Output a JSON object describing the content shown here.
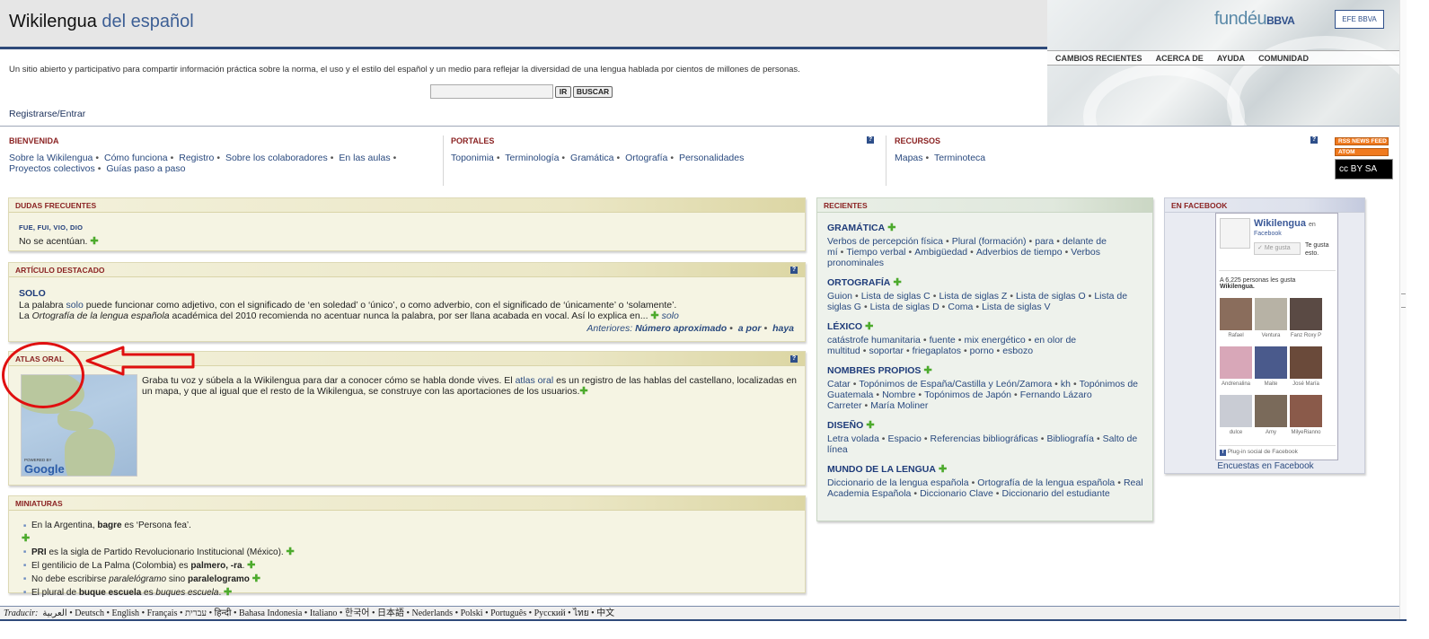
{
  "header": {
    "title_main": "Wikilengua",
    "title_sub": " del español",
    "tagline": "Un sitio abierto y participativo para compartir información práctica sobre la norma, el uso y el estilo del español y un medio para reflejar la diversidad de una lengua hablada por cientos de millones de personas.",
    "search": {
      "value": "",
      "go_label": "IR",
      "search_label": "BUSCAR"
    },
    "login_label": "Registrarse/Entrar",
    "fundeu": "fundéu",
    "fundeu_bbva": "BBVA",
    "efe_logo": "EFE  BBVA",
    "nav": [
      "CAMBIOS RECIENTES",
      "ACERCA DE",
      "AYUDA",
      "COMUNIDAD"
    ]
  },
  "portals": {
    "bienvenida": {
      "title": "BIENVENIDA",
      "links": [
        "Sobre la Wikilengua",
        "Cómo funciona",
        "Registro",
        "Sobre los colaboradores",
        "En las aulas",
        "Proyectos colectivos",
        "Guías paso a paso"
      ]
    },
    "portales": {
      "title": "PORTALES",
      "links": [
        "Toponimia",
        "Terminología",
        "Gramática",
        "Ortografía",
        "Personalidades"
      ]
    },
    "recursos": {
      "title": "RECURSOS",
      "links": [
        "Mapas",
        "Terminoteca"
      ]
    },
    "help_glyph": "?"
  },
  "feeds": {
    "rss": "RSS NEWS FEED",
    "atom": "ATOM",
    "cc": "cc  BY  SA"
  },
  "dudas": {
    "title": "DUDAS FRECUENTES",
    "item_title": "FUE, FUI, VIO, DIO",
    "item_text": "No se acentúan."
  },
  "articulo": {
    "title": "ARTÍCULO DESTACADO",
    "word": "SOLO",
    "p1_a": "La palabra ",
    "p1_link": "solo",
    "p1_b": " puede funcionar como adjetivo, con el significado de ‘en soledad’ o ‘único’, o como adverbio, con el significado de ‘únicamente’ o ‘solamente’.",
    "p2_a": "La ",
    "p2_em": "Ortografía de la lengua española",
    "p2_b": " académica del 2010 recomienda no acentuar nunca la palabra, por ser llana acabada en vocal. Así lo explica en...",
    "p2_more": "solo",
    "prev_label": "Anteriores:",
    "prev": [
      "Número aproximado",
      "a por",
      "haya"
    ]
  },
  "atlas": {
    "title": "ATLAS ORAL",
    "text_a": "Graba tu voz y súbela a la Wikilengua para dar a conocer cómo se habla donde vives. El ",
    "text_link": "atlas oral",
    "text_b": " es un registro de las hablas del castellano, localizadas en un mapa, y que al igual que el resto de la Wikilengua, se construye con las aportaciones de los usuarios.",
    "map_powered": "POWERED BY",
    "map_google": "Google"
  },
  "miniaturas": {
    "title": "MINIATURAS",
    "items": [
      {
        "a": "En la Argentina, ",
        "b": "bagre",
        "c": " es ‘Persona fea’.",
        "d": "",
        "e": ""
      },
      {
        "a": "",
        "b": "PRI",
        "c": " es la sigla de Partido Revolucionario Institucional (México).",
        "d": "",
        "e": ""
      },
      {
        "a": "El gentilicio de La Palma (Colombia) es ",
        "b": "palmero, -ra",
        "c": ".",
        "d": "",
        "e": ""
      },
      {
        "a": "No debe escribirse ",
        "b": "paralelógramo",
        "c": " sino ",
        "d": "paralelogramo",
        "e": ""
      },
      {
        "a": "El plural de ",
        "b": "buque escuela",
        "c": " es ",
        "d": "buques escuela",
        "e": "."
      }
    ]
  },
  "recientes": {
    "title": "RECIENTES",
    "cats": [
      {
        "name": "GRAMÁTICA",
        "links": [
          "Verbos de percepción física",
          "Plural (formación)",
          "para",
          "delante de mí",
          "Tiempo verbal",
          "Ambigüedad",
          "Adverbios de tiempo",
          "Verbos pronominales"
        ]
      },
      {
        "name": "ORTOGRAFÍA",
        "links": [
          "Guion",
          "Lista de siglas C",
          "Lista de siglas Z",
          "Lista de siglas O",
          "Lista de siglas G",
          "Lista de siglas D",
          "Coma",
          "Lista de siglas V"
        ]
      },
      {
        "name": "LÉXICO",
        "links": [
          "catástrofe humanitaria",
          "fuente",
          "mix energético",
          "en olor de multitud",
          "soportar",
          "friegaplatos",
          "porno",
          "esbozo"
        ]
      },
      {
        "name": "NOMBRES PROPIOS",
        "links": [
          "Catar",
          "Topónimos de España/Castilla y León/Zamora",
          "kh",
          "Topónimos de Guatemala",
          "Nombre",
          "Topónimos de Japón",
          "Fernando Lázaro Carreter",
          "María Moliner"
        ]
      },
      {
        "name": "DISEÑO",
        "links": [
          "Letra volada",
          "Espacio",
          "Referencias bibliográficas",
          "Bibliografía",
          "Salto de línea"
        ]
      },
      {
        "name": "MUNDO DE LA LENGUA",
        "links": [
          "Diccionario de la lengua española",
          "Ortografía de la lengua española",
          "Real Academia Española",
          "Diccionario Clave",
          "Diccionario del estudiante"
        ]
      }
    ]
  },
  "facebook": {
    "title": "EN FACEBOOK",
    "page_name": "Wikilengua",
    "page_on": "en",
    "page_fb": "Facebook",
    "like_label": "Me gusta",
    "like_text": "Te gusta esto.",
    "count_text": "A 6,225 personas les gusta",
    "count_page": "Wikilengua.",
    "faces": [
      "Rafael",
      "Ventura",
      "Fanz Roxy P",
      "Andrenalina",
      "Maite",
      "José María",
      "dulce",
      "Amy",
      "MilyeRianno"
    ],
    "plugin_label": "Plug-in social de Facebook",
    "polls_link": "Encuestas en Facebook"
  },
  "translate": {
    "label": "Traducir:",
    "langs": [
      "العربية",
      "Deutsch",
      "English",
      "Français",
      "עברית",
      "हिन्दी",
      "Bahasa Indonesia",
      "Italiano",
      "한국어",
      "日本語",
      "Nederlands",
      "Polski",
      "Português",
      "Русский",
      "ไทย",
      "中文"
    ]
  },
  "colors": {
    "accent_red": "#8b2323",
    "link_blue": "#2a4a7f",
    "header_rule": "#2f4a7a",
    "annotation_red": "#e01010"
  }
}
